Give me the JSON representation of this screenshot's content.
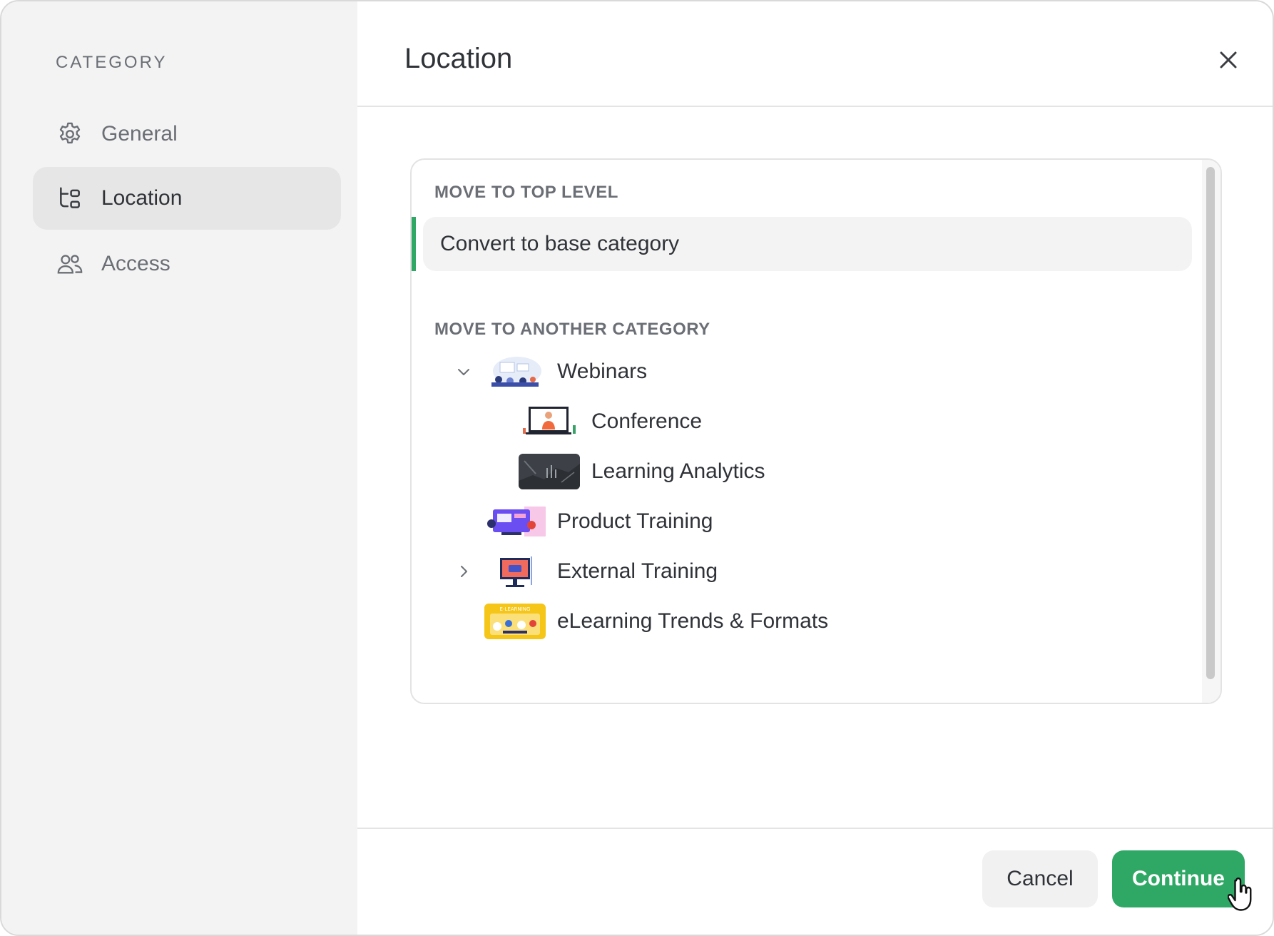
{
  "sidebar": {
    "heading": "CATEGORY",
    "items": [
      {
        "label": "General",
        "icon": "gear-icon",
        "active": false
      },
      {
        "label": "Location",
        "icon": "tree-structure-icon",
        "active": true
      },
      {
        "label": "Access",
        "icon": "users-icon",
        "active": false
      }
    ]
  },
  "header": {
    "title": "Location"
  },
  "panel": {
    "top_level_label": "MOVE TO TOP LEVEL",
    "base_option": "Convert to base category",
    "another_label": "MOVE TO ANOTHER CATEGORY",
    "tree": [
      {
        "label": "Webinars",
        "expanded": true,
        "level": 0
      },
      {
        "label": "Conference",
        "level": 1
      },
      {
        "label": "Learning Analytics",
        "level": 1
      },
      {
        "label": "Product Training",
        "level": 0
      },
      {
        "label": "External Training",
        "expanded": false,
        "level": 0
      },
      {
        "label": "eLearning Trends & Formats",
        "level": 0
      }
    ],
    "thumb_text_elearning": "E-LEARNING"
  },
  "footer": {
    "cancel_label": "Cancel",
    "continue_label": "Continue"
  },
  "colors": {
    "accent": "#2fa866",
    "sidebar_bg": "#f3f3f3",
    "text": "#2f3237",
    "muted": "#6b6f75"
  }
}
